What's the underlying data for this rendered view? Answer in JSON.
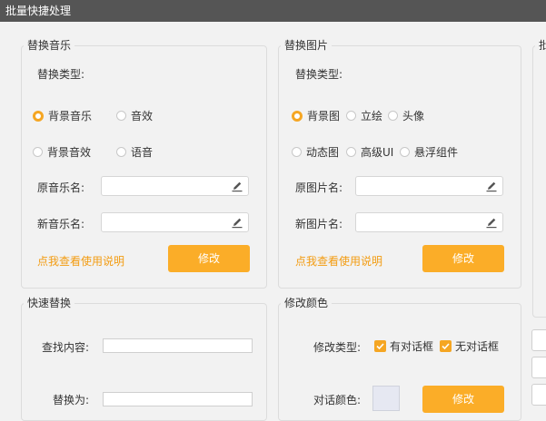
{
  "window": {
    "title": "批量快捷处理"
  },
  "music": {
    "group_title": "替换音乐",
    "type_label": "替换类型:",
    "options": [
      "背景音乐",
      "音效",
      "背景音效",
      "语音"
    ],
    "selected": "背景音乐",
    "original_label": "原音乐名:",
    "new_label": "新音乐名:",
    "original_value": "",
    "new_value": "",
    "help_link": "点我查看使用说明",
    "modify_button": "修改"
  },
  "image": {
    "group_title": "替换图片",
    "type_label": "替换类型:",
    "options": [
      "背景图",
      "立绘",
      "头像",
      "动态图",
      "高级UI",
      "悬浮组件"
    ],
    "selected": "背景图",
    "original_label": "原图片名:",
    "new_label": "新图片名:",
    "original_value": "",
    "new_value": "",
    "help_link": "点我查看使用说明",
    "modify_button": "修改"
  },
  "quick": {
    "group_title": "快速替换",
    "find_label": "查找内容:",
    "replace_label": "替换为:",
    "find_value": "",
    "replace_value": ""
  },
  "color": {
    "group_title": "修改颜色",
    "type_label": "修改类型:",
    "checks": [
      {
        "label": "有对话框",
        "checked": true
      },
      {
        "label": "无对话框",
        "checked": true
      }
    ],
    "dialog_color_label": "对话颜色:",
    "dialog_color": "#e6e8f2",
    "modify_button": "修改"
  },
  "right_partial": {
    "group_title_fragment": "批"
  },
  "colors": {
    "accent": "#fbad28",
    "titlebar": "#555555",
    "link": "#f39c12"
  }
}
